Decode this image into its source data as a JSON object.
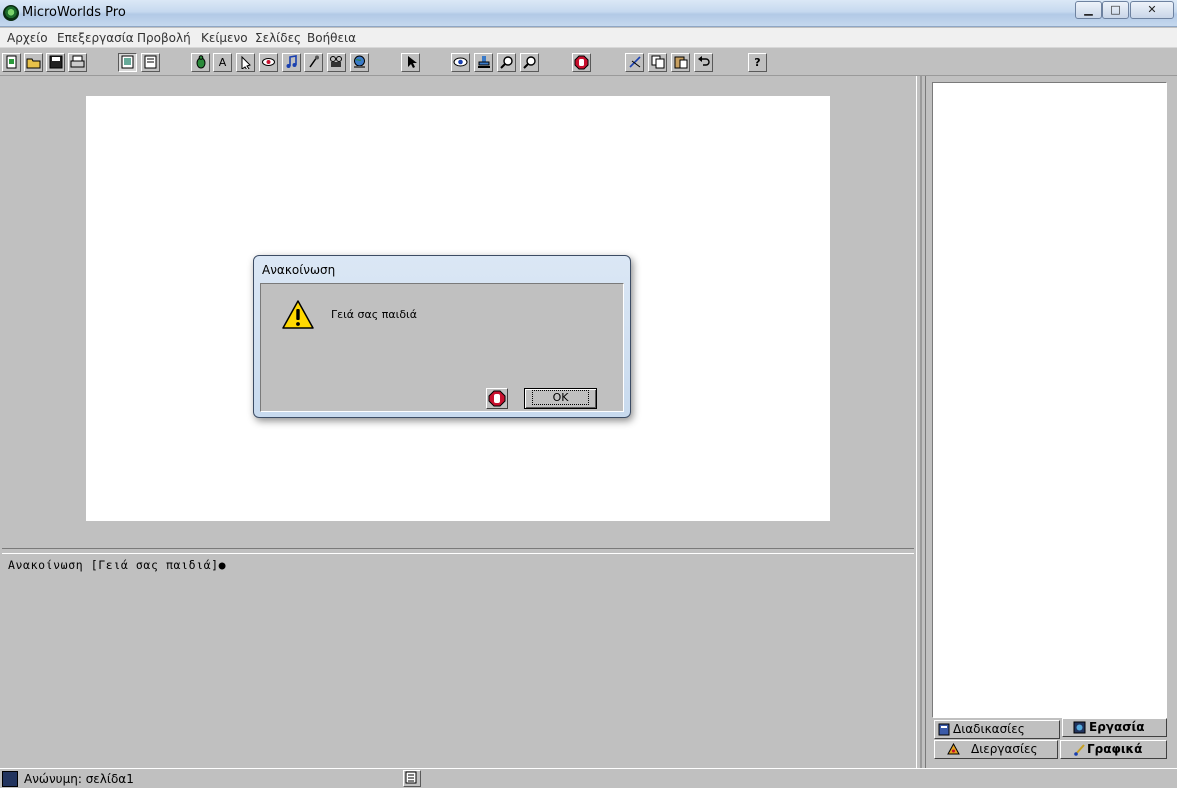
{
  "window": {
    "title": "MicroWorlds Pro",
    "minimize_glyph": "▁",
    "maximize_glyph": "□",
    "close_glyph": "✕"
  },
  "menu": {
    "items": [
      "Αρχείο",
      "Επεξεργασία",
      "Προβολή",
      "Κείμενο",
      "Σελίδες",
      "Βοήθεια"
    ]
  },
  "toolbar": {
    "text_tool_glyph": "A",
    "help_glyph": "?"
  },
  "command_center": {
    "text": "Ανακοίνωση [Γειά σας παιδιά]●"
  },
  "tabs": {
    "procedures": "Διαδικασίες",
    "project": "Εργασία",
    "processes": "Διεργασίες",
    "graphics": "Γραφικά"
  },
  "status": {
    "text": "Ανώνυμη:  σελίδα1"
  },
  "dialog": {
    "title": "Ανακοίνωση",
    "message": "Γειά σας παιδιά",
    "ok_label": "OK"
  },
  "colors": {
    "page_background": "#ffffff",
    "workspace": "#c0c0c0",
    "stop_red": "#c8102e",
    "warning_yellow": "#ffd800"
  }
}
